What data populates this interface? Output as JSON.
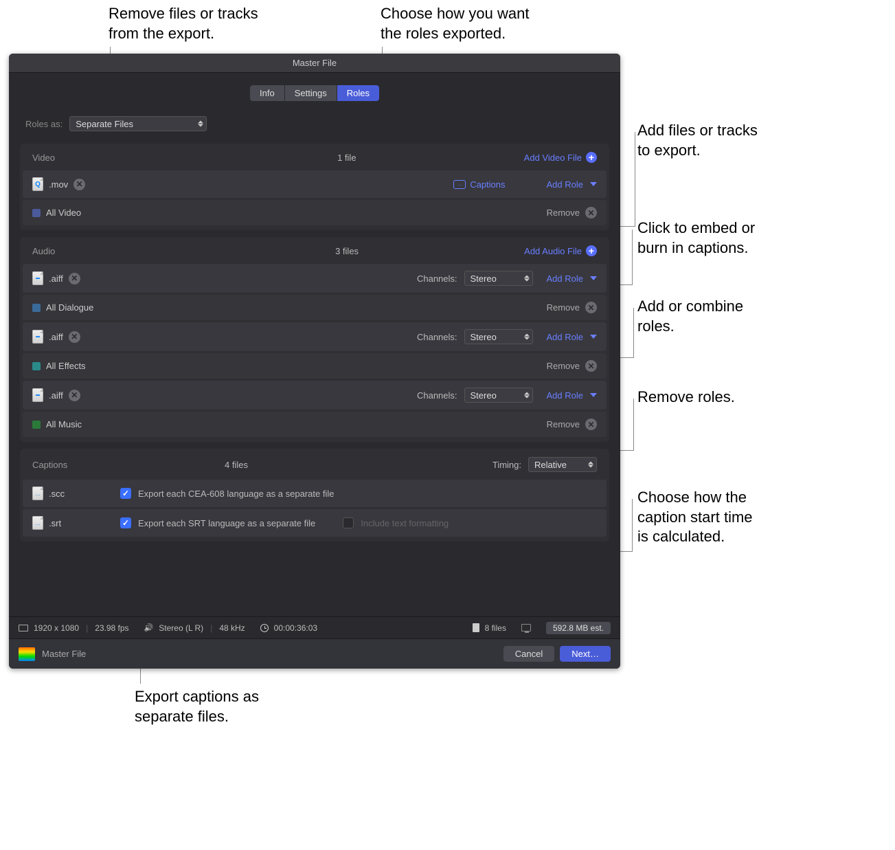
{
  "window_title": "Master File",
  "tabs": {
    "info": "Info",
    "settings": "Settings",
    "roles": "Roles"
  },
  "roles_as": {
    "label": "Roles as:",
    "value": "Separate Files"
  },
  "video": {
    "header": "Video",
    "count": "1 file",
    "add_btn": "Add Video File",
    "file_ext": ".mov",
    "captions_link": "Captions",
    "add_role": "Add Role",
    "roles": [
      {
        "color": "#4a5a9a",
        "name": "All Video",
        "remove": "Remove"
      }
    ]
  },
  "audio": {
    "header": "Audio",
    "count": "3 files",
    "add_btn": "Add Audio File",
    "channels_label": "Channels:",
    "channels_value": "Stereo",
    "add_role": "Add Role",
    "file_ext": ".aiff",
    "remove": "Remove",
    "files": [
      {
        "role": {
          "color": "#3a6a9a",
          "name": "All Dialogue"
        }
      },
      {
        "role": {
          "color": "#2a8a8a",
          "name": "All Effects"
        }
      },
      {
        "role": {
          "color": "#2a8a3a",
          "name": "All Music"
        }
      }
    ]
  },
  "captions": {
    "header": "Captions",
    "count": "4 files",
    "timing_label": "Timing:",
    "timing_value": "Relative",
    "rows": [
      {
        "ext": ".scc",
        "desc": "Export each CEA-608 language as a separate file",
        "include_label": ""
      },
      {
        "ext": ".srt",
        "desc": "Export each SRT language as a separate file",
        "include_label": "Include text formatting"
      }
    ]
  },
  "status": {
    "res": "1920 x 1080",
    "fps": "23.98 fps",
    "audio": "Stereo (L R)",
    "khz": "48 kHz",
    "timecode": "00:00:36:03",
    "files": "8 files",
    "size": "592.8 MB est."
  },
  "footer": {
    "title": "Master File",
    "cancel": "Cancel",
    "next": "Next…"
  },
  "callouts": {
    "c1": "Remove files or tracks from the export.",
    "c2": "Choose how you want the roles exported.",
    "c3": "Add files or tracks to export.",
    "c4": "Click to embed or burn in captions.",
    "c5": "Add or combine roles.",
    "c6": "Remove roles.",
    "c7": "Choose how the caption start time is calculated.",
    "c8": "Export captions as separate files."
  }
}
